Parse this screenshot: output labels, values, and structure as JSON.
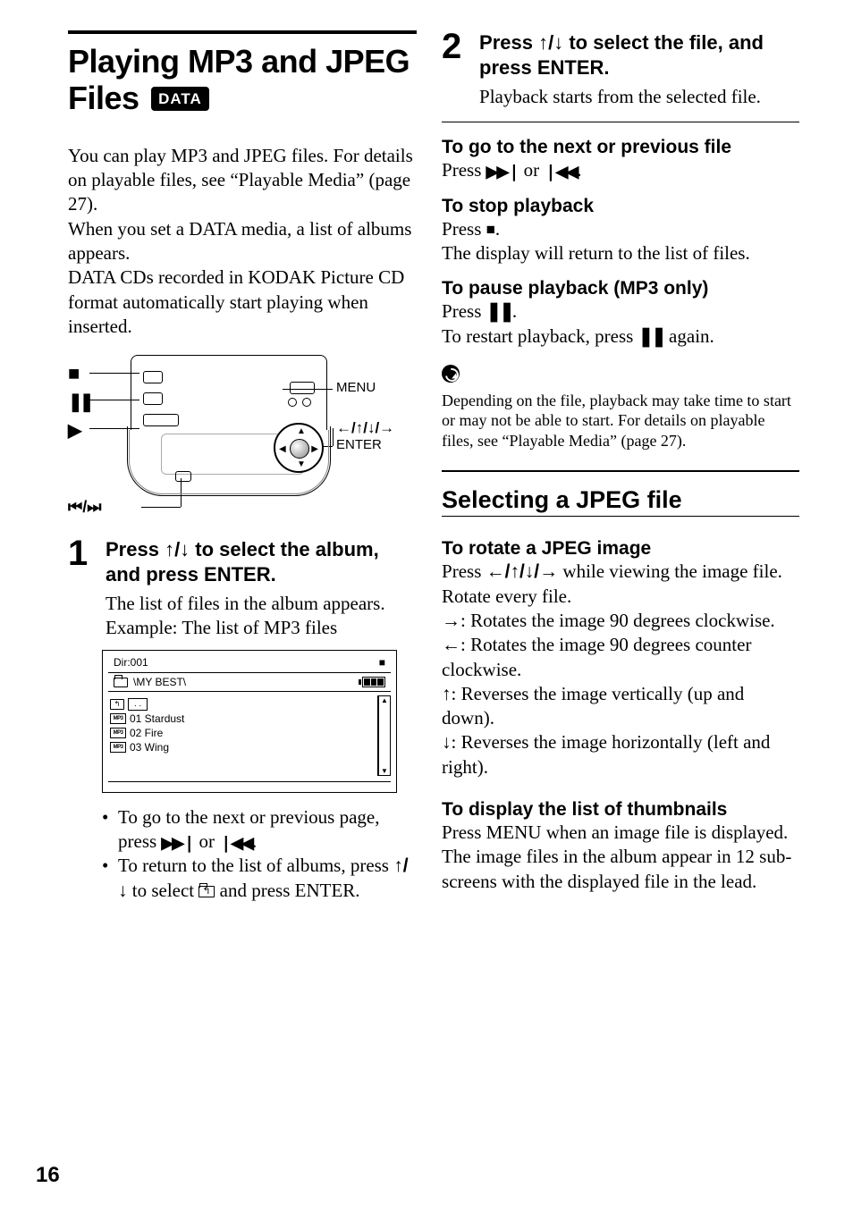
{
  "page_number": "16",
  "title_line1": "Playing MP3 and JPEG",
  "title_line2": "Files",
  "title_badge": "DATA",
  "intro": "You can play MP3 and JPEG files. For details on playable files, see “Playable Media” (page 27).\nWhen you set a DATA media, a list of albums appears.\nDATA CDs recorded in KODAK Picture CD format automatically start playing when inserted.",
  "remote": {
    "label_stop": "■",
    "label_pause": "❚❚",
    "label_play": "▶",
    "label_skip": "⏮/⏭",
    "label_menu": "MENU",
    "label_arrows": "←/↑/↓/→",
    "label_enter": "ENTER"
  },
  "step1": {
    "num": "1",
    "title_a": "Press ",
    "title_arrows": "↑/↓",
    "title_b": " to select the album, and press ENTER.",
    "body": "The list of files in the album appears. Example: The list of MP3 files"
  },
  "screen": {
    "dir": "Dir:001",
    "stop": "■",
    "path": "\\MY BEST\\",
    "up": "↰",
    "dots": ". .",
    "files": [
      "01 Stardust",
      "02 Fire",
      "03 Wing"
    ],
    "mp3": "MP3",
    "scroll_up": "▲",
    "scroll_dn": "▼"
  },
  "bullets": {
    "b1a": "To go to the next or previous page, press ",
    "b1_fwd": "▶▶❘",
    "b1_or": " or ",
    "b1_back": "❘◀◀",
    "b1_end": ".",
    "b2a": "To return to the list of albums, press ",
    "b2_arrows": "↑/↓",
    "b2b": " to select ",
    "b2c": " and press ENTER."
  },
  "step2": {
    "num": "2",
    "title_a": "Press ",
    "title_arrows": "↑/↓",
    "title_b": " to select the file, and press ENTER.",
    "body": "Playback starts from the selected file."
  },
  "r1": {
    "h": "To go to the next or previous file",
    "a": "Press ",
    "fwd": "▶▶❘",
    "or": " or ",
    "back": "❘◀◀",
    "end": "."
  },
  "r2": {
    "h": "To stop playback",
    "a": "Press ",
    "g": "■",
    "b": ".",
    "c": "The display will return to the list of files."
  },
  "r3": {
    "h": "To pause playback (MP3 only)",
    "a": "Press ",
    "g": "❚❚",
    "b": ".",
    "c": "To restart playback, press ",
    "g2": "❚❚",
    "d": " again."
  },
  "note": "Depending on the file, playback may take time to start or may not be able to start. For details on playable files, see “Playable Media” (page 27).",
  "section2": "Selecting a JPEG file",
  "rot": {
    "h": "To rotate a JPEG image",
    "a1": "Press ",
    "arrows": "←/↑/↓/→",
    "a2": " while viewing the image file. Rotate every file.",
    "r": "→",
    "r_txt": ": Rotates the image 90 degrees clockwise.",
    "l": "←",
    "l_txt": ": Rotates the image 90 degrees counter clockwise.",
    "u": "↑",
    "u_txt": ": Reverses the image vertically (up and down).",
    "d": "↓",
    "d_txt": ": Reverses the image horizontally (left and right)."
  },
  "thumb": {
    "h": "To display the list of thumbnails",
    "body": "Press MENU when an image file is displayed.\nThe image files in the album appear in 12 sub-screens with the displayed file in the lead."
  }
}
